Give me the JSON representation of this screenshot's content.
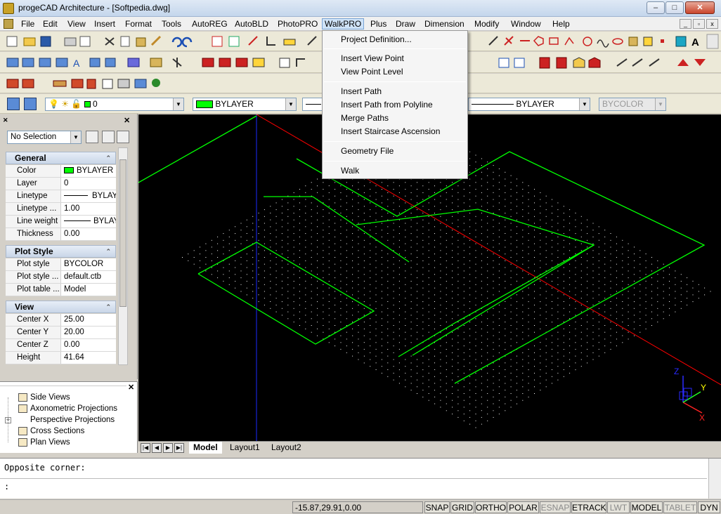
{
  "window": {
    "title": "progeCAD Architecture  - [Softpedia.dwg]",
    "minimize": "–",
    "restore": "□",
    "close": "✕"
  },
  "menubar": {
    "items": [
      "File",
      "Edit",
      "View",
      "Insert",
      "Format",
      "Tools",
      "AutoREG",
      "AutoBLD",
      "PhotoPRO",
      "WalkPRO",
      "Plus",
      "Draw",
      "Dimension",
      "Modify",
      "Window",
      "Help"
    ],
    "open_item": "WalkPRO"
  },
  "walk_menu": {
    "items": [
      "Project Definition...",
      "Insert View Point",
      "View Point Level",
      "Insert Path",
      "Insert Path from Polyline",
      "Merge Paths",
      "Insert Staircase Ascension",
      "Geometry File",
      "Walk"
    ]
  },
  "layerbar": {
    "layer": "0",
    "color": "BYLAYER",
    "lineweight": "BYLAYER",
    "plotstyle": "BYCOLOR"
  },
  "properties": {
    "selection": "No Selection",
    "sections": {
      "general": {
        "title": "General",
        "rows": [
          {
            "k": "Color",
            "v": "BYLAYER"
          },
          {
            "k": "Layer",
            "v": "0"
          },
          {
            "k": "Linetype",
            "v": "BYLAYER"
          },
          {
            "k": "Linetype ...",
            "v": "1.00"
          },
          {
            "k": "Line weight",
            "v": "BYLAYER"
          },
          {
            "k": "Thickness",
            "v": "0.00"
          }
        ]
      },
      "plot": {
        "title": "Plot Style",
        "rows": [
          {
            "k": "Plot style",
            "v": "BYCOLOR"
          },
          {
            "k": "Plot style ...",
            "v": "default.ctb"
          },
          {
            "k": "Plot table ...",
            "v": "Model"
          }
        ]
      },
      "view": {
        "title": "View",
        "rows": [
          {
            "k": "Center X",
            "v": "25.00"
          },
          {
            "k": "Center Y",
            "v": "20.00"
          },
          {
            "k": "Center Z",
            "v": "0.00"
          },
          {
            "k": "Height",
            "v": "41.64"
          }
        ]
      }
    }
  },
  "tree": {
    "items": [
      "Side Views",
      "Axonometric Projections",
      "Perspective Projections",
      "Cross Sections",
      "Plan Views"
    ]
  },
  "layout_tabs": [
    "Model",
    "Layout1",
    "Layout2"
  ],
  "ucs": {
    "x": "X",
    "y": "Y",
    "z": "Z"
  },
  "command": {
    "line1": "Opposite corner:",
    "line2": ":"
  },
  "status": {
    "coords": "-15.87,29.91,0.00",
    "buttons": [
      "SNAP",
      "GRID",
      "ORTHO",
      "POLAR",
      "ESNAP",
      "ETRACK",
      "LWT",
      "MODEL",
      "TABLET",
      "DYN"
    ],
    "off": [
      "ESNAP",
      "LWT",
      "TABLET"
    ]
  },
  "colors": {
    "grid_dots": "#ffffff",
    "outline": "#00ff00",
    "axis_x": "#ff0000",
    "axis_y": "#0000ff"
  }
}
